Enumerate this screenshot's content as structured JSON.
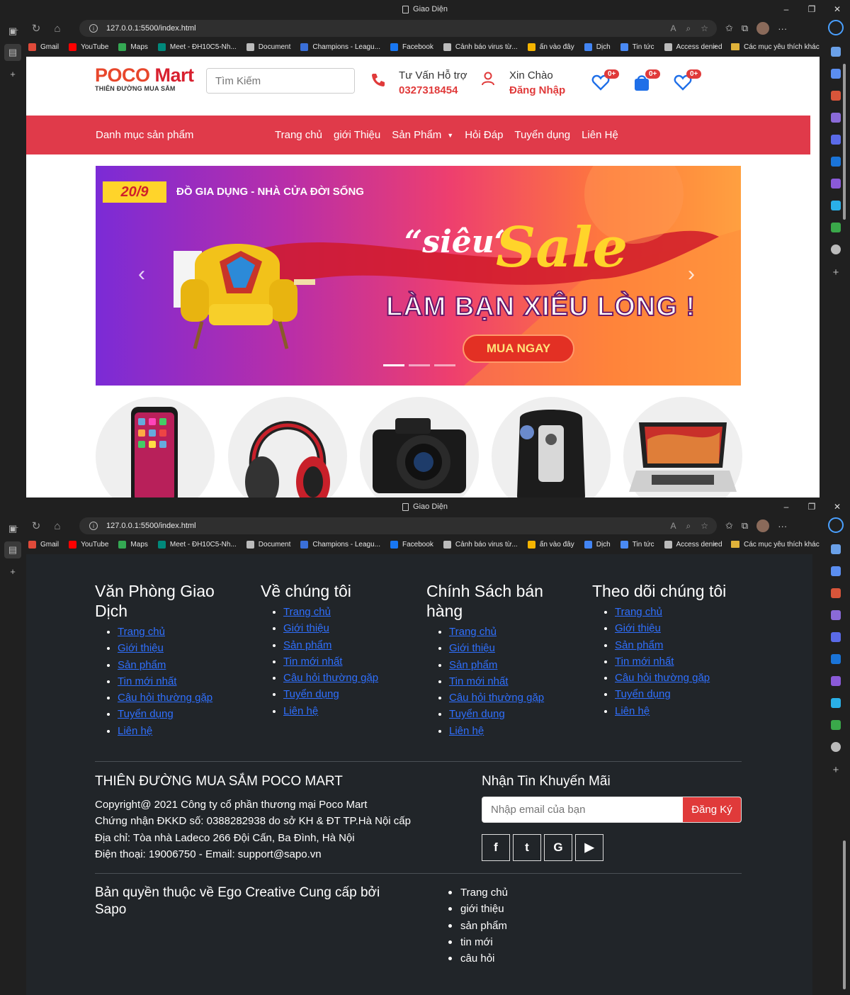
{
  "browser": {
    "title": "Giao Diện",
    "url": "127.0.0.1:5500/index.html",
    "bookmarks": [
      {
        "label": "Gmail",
        "color": "#e04a3a"
      },
      {
        "label": "YouTube",
        "color": "#ff0000"
      },
      {
        "label": "Maps",
        "color": "#34a853"
      },
      {
        "label": "Meet - ĐH10C5-Nh...",
        "color": "#00897b"
      },
      {
        "label": "Document",
        "color": "#bbbbbb"
      },
      {
        "label": "Champions - Leagu...",
        "color": "#3a6fd8"
      },
      {
        "label": "Facebook",
        "color": "#1877f2"
      },
      {
        "label": "Cảnh báo virus từ...",
        "color": "#bbbbbb"
      },
      {
        "label": "ấn vào đây",
        "color": "#f4b400"
      },
      {
        "label": "Dịch",
        "color": "#4285f4"
      },
      {
        "label": "Tin tức",
        "color": "#4a8af4"
      },
      {
        "label": "Access denied",
        "color": "#bbbbbb"
      }
    ],
    "bookmarks_more": ">",
    "other_bookmarks": "Các mục yêu thích khác"
  },
  "header": {
    "logo_main": "POCO",
    "logo_accent": "Mart",
    "logo_tagline": "THIÊN ĐƯỜNG MUA SẮM",
    "search_placeholder": "Tìm Kiếm",
    "support_title": "Tư Vấn Hỗ trợ",
    "support_phone": "0327318454",
    "greeting": "Xin Chào",
    "login": "Đăng Nhập",
    "badges": [
      "0+",
      "0+",
      "0+"
    ]
  },
  "nav": {
    "category": "Danh mục sản phẩm",
    "links": [
      "Trang chủ",
      "giới Thiệu",
      "Sản Phẩm",
      "Hỏi Đáp",
      "Tuyển dụng",
      "Liên Hệ"
    ]
  },
  "banner": {
    "date": "20/9",
    "subtitle": "ĐỒ GIA DỤNG - NHÀ CỬA ĐỜI SỐNG",
    "headline_small": "“siêu“",
    "headline_big": "Sale",
    "slogan": "LÀM BẠN XIÊU LÒNG !",
    "cta": "MUA NGAY",
    "prev": "‹",
    "next": "›"
  },
  "footer": {
    "columns": [
      {
        "title": "Văn Phòng Giao Dịch",
        "links": [
          "Trang chủ",
          "Giới thiệu",
          "Sản phẩm",
          "Tin mới nhất",
          "Câu hỏi thường gặp",
          "Tuyển dụng",
          "Liên hệ"
        ]
      },
      {
        "title": "Về chúng tôi",
        "links": [
          "Trang chủ",
          "Giới thiệu",
          "Sản phẩm",
          "Tin mới nhất",
          "Câu hỏi thường gặp",
          "Tuyển dụng",
          "Liên hệ"
        ]
      },
      {
        "title": "Chính Sách bán hàng",
        "links": [
          "Trang chủ",
          "Giới thiệu",
          "Sản phẩm",
          "Tin mới nhất",
          "Câu hỏi thường gặp",
          "Tuyển dụng",
          "Liên hệ"
        ]
      },
      {
        "title": "Theo dõi chúng tôi",
        "links": [
          "Trang chủ",
          "Giới thiệu",
          "Sản phẩm",
          "Tin mới nhất",
          "Câu hỏi thường gặp",
          "Tuyển dụng",
          "Liên hệ"
        ]
      }
    ],
    "about_title": "THIÊN ĐƯỜNG MUA SẮM POCO MART",
    "about_lines": [
      "Copyright@ 2021 Công ty cổ phần thương mại Poco Mart",
      "Chứng nhận ĐKKD số: 0388282938 do sở KH & ĐT TP.Hà Nội cấp",
      "Địa chỉ: Tòa nhà Ladeco 266 Đội Cấn, Ba Đình, Hà Nội",
      "Điện thoại: 19006750 - Email: support@sapo.vn"
    ],
    "newsletter_title": "Nhận Tin Khuyến Mãi",
    "newsletter_placeholder": "Nhập email của bạn",
    "newsletter_button": "Đăng Ký",
    "social": [
      "f",
      "t",
      "G",
      "▶"
    ],
    "copyright": "Bản quyền thuộc về Ego Creative Cung cấp bởi Sapo",
    "bottom_links": [
      "Trang chủ",
      "giới thiệu",
      "sản phẩm",
      "tin mới",
      "câu hỏi"
    ]
  }
}
